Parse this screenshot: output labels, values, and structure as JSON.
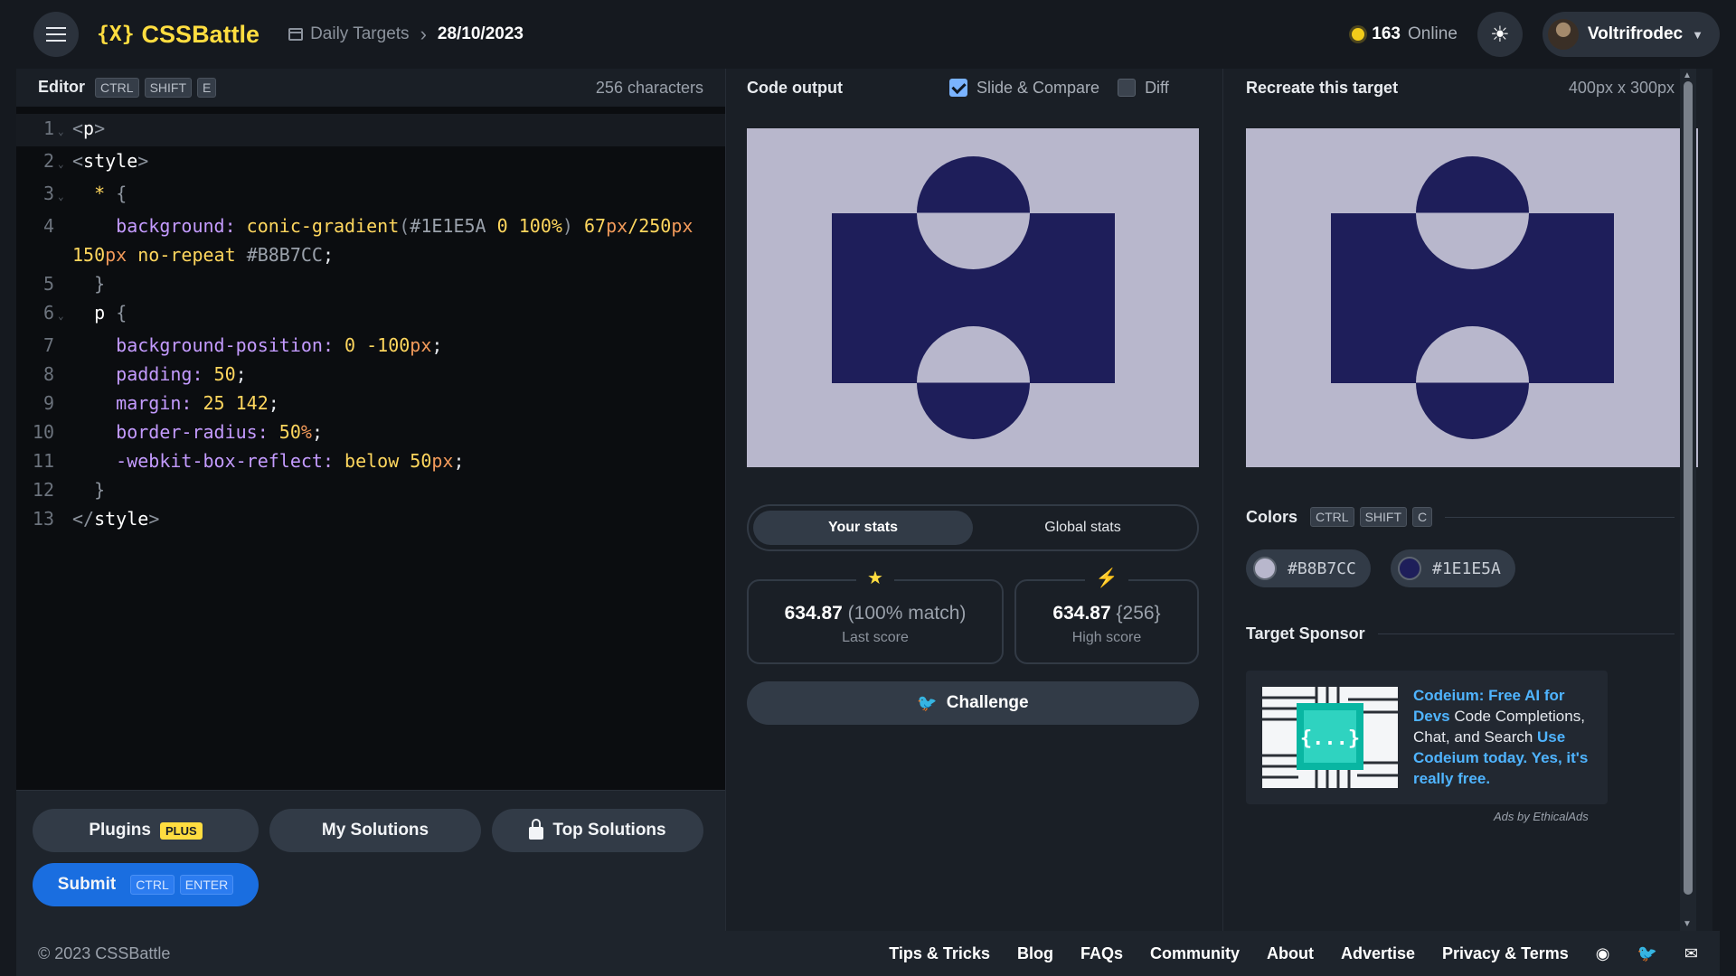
{
  "header": {
    "logo_mark": "{X}",
    "logo_text": "CSSBattle",
    "breadcrumb_link": "Daily Targets",
    "breadcrumb_current": "28/10/2023",
    "online_count": "163",
    "online_label": "Online",
    "username": "Voltrifrodec"
  },
  "editor": {
    "title": "Editor",
    "shortcut": [
      "CTRL",
      "SHIFT",
      "E"
    ],
    "char_count": "256 characters",
    "line_numbers": [
      "1",
      "2",
      "3",
      "4",
      "5",
      "6",
      "7",
      "8",
      "9",
      "10",
      "11",
      "12",
      "13"
    ]
  },
  "code": {
    "l1_tag": "p",
    "l2_tag": "style",
    "l3_sel": "*",
    "l4_prop": "background:",
    "l4_fn": "conic-gradient",
    "l4_hex1": "#1E1E5A",
    "l4_n1": "0",
    "l4_n2": "100%",
    "l4_n3": "67",
    "l4_u1": "px",
    "l4_n4": "/250",
    "l4_u2": "px",
    "l4_n5": "150",
    "l4_u3": "px",
    "l4_nr": "no-repeat",
    "l4_hex2": "#B8B7CC",
    "l6_sel": "p",
    "l7_prop": "background-position:",
    "l7_val": "0 -100",
    "l7_u": "px",
    "l8_prop": "padding:",
    "l8_val": "50",
    "l9_prop": "margin:",
    "l9_val": "25 142",
    "l10_prop": "border-radius:",
    "l10_val": "50",
    "l10_u": "%",
    "l11_prop": "-webkit-box-reflect:",
    "l11_val": "below 50",
    "l11_u": "px",
    "l13_tag": "style"
  },
  "editor_footer": {
    "plugins": "Plugins",
    "plugins_badge": "PLUS",
    "my_solutions": "My Solutions",
    "top_solutions": "Top Solutions",
    "submit": "Submit",
    "submit_keys": [
      "CTRL",
      "ENTER"
    ]
  },
  "output": {
    "title": "Code output",
    "slide_compare": "Slide & Compare",
    "slide_compare_checked": true,
    "diff": "Diff",
    "diff_checked": false
  },
  "stats": {
    "tab_your": "Your stats",
    "tab_global": "Global stats",
    "last_score_value": "634.87",
    "last_score_match": "(100% match)",
    "last_score_label": "Last score",
    "high_score_value": "634.87",
    "high_score_chars": "{256}",
    "high_score_label": "High score",
    "challenge": "Challenge"
  },
  "target": {
    "title": "Recreate this target",
    "size": "400px x 300px",
    "colors_title": "Colors",
    "colors_shortcut": [
      "CTRL",
      "SHIFT",
      "C"
    ],
    "colors": [
      {
        "hex": "#B8B7CC",
        "value": "#b8b7cc"
      },
      {
        "hex": "#1E1E5A",
        "value": "#1e1e5a"
      }
    ],
    "sponsor_title": "Target Sponsor",
    "ad_link1": "Codeium: Free AI for Devs",
    "ad_text": " Code Completions, Chat, and Search ",
    "ad_link2": "Use Codeium today. Yes, it's really free.",
    "ad_by": "Ads by EthicalAds"
  },
  "footer": {
    "copyright": "© 2023 CSSBattle",
    "links": [
      "Tips & Tricks",
      "Blog",
      "FAQs",
      "Community",
      "About",
      "Advertise",
      "Privacy & Terms"
    ]
  },
  "colors": {
    "accent_yellow": "#ffdd40",
    "submit_blue": "#1a6ee0",
    "target_bg": "#b8b7cc",
    "target_fg": "#1e1e5a"
  }
}
